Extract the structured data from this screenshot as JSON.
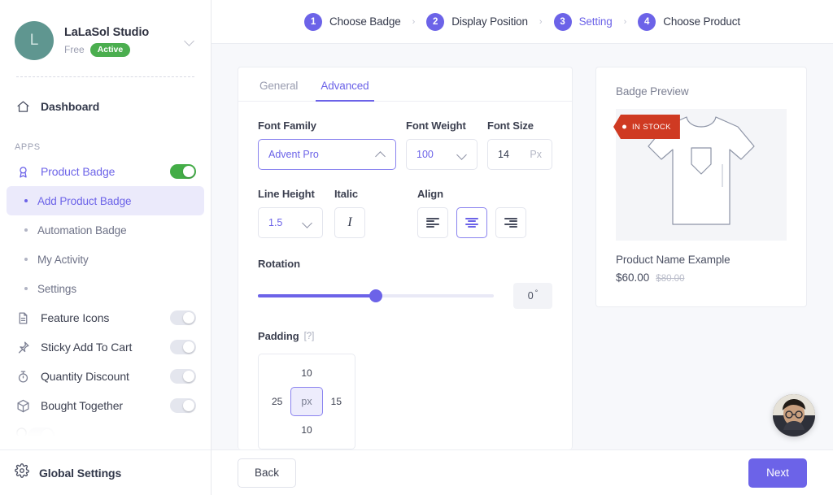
{
  "sidebar": {
    "account": {
      "initial": "L",
      "name": "LaLaSol Studio",
      "plan": "Free",
      "status": "Active"
    },
    "dashboard_label": "Dashboard",
    "apps_heading": "APPS",
    "product_badge": {
      "label": "Product Badge",
      "toggle": "on"
    },
    "sub_items": [
      {
        "label": "Add Product Badge"
      },
      {
        "label": "Automation Badge"
      },
      {
        "label": "My Activity"
      },
      {
        "label": "Settings"
      }
    ],
    "apps": [
      {
        "label": "Feature Icons",
        "toggle": "off"
      },
      {
        "label": "Sticky Add To Cart",
        "toggle": "off"
      },
      {
        "label": "Quantity Discount",
        "toggle": "off"
      },
      {
        "label": "Bought Together",
        "toggle": "off"
      }
    ],
    "footer_label": "Global Settings"
  },
  "steps": [
    {
      "num": "1",
      "label": "Choose Badge"
    },
    {
      "num": "2",
      "label": "Display Position"
    },
    {
      "num": "3",
      "label": "Setting"
    },
    {
      "num": "4",
      "label": "Choose Product"
    }
  ],
  "step_separator": "›",
  "tabs": [
    {
      "label": "General"
    },
    {
      "label": "Advanced"
    }
  ],
  "form": {
    "font_family": {
      "label": "Font Family",
      "value": "Advent Pro"
    },
    "font_weight": {
      "label": "Font Weight",
      "value": "100"
    },
    "font_size": {
      "label": "Font Size",
      "value": "14",
      "unit": "Px"
    },
    "line_height": {
      "label": "Line Height",
      "value": "1.5"
    },
    "italic": {
      "label": "Italic",
      "glyph": "I"
    },
    "align": {
      "label": "Align",
      "selected": "center"
    },
    "rotation": {
      "label": "Rotation",
      "value": "0",
      "unit": "°",
      "percent": 50
    },
    "padding": {
      "label": "Padding",
      "help": "[?]",
      "top": "10",
      "right": "15",
      "bottom": "10",
      "left": "25",
      "unit": "px"
    }
  },
  "preview": {
    "title": "Badge Preview",
    "badge_text": "IN STOCK",
    "badge_color": "#cf3a22",
    "product_name": "Product Name Example",
    "price": "$60.00",
    "old_price": "$80.00"
  },
  "footer": {
    "back_label": "Back",
    "next_label": "Next"
  },
  "colors": {
    "accent": "#6c63e8",
    "toggle_on": "#43ad47",
    "badge_active": "#4bae4f"
  }
}
